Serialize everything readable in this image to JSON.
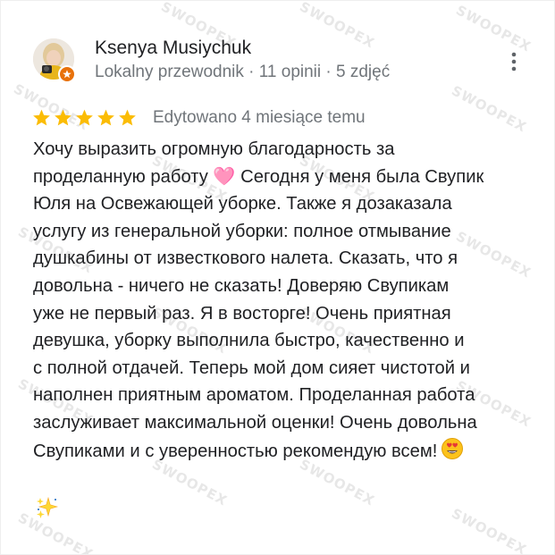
{
  "reviewer": {
    "name": "Ksenya Musiychuk",
    "meta": "Lokalny przewodnik · 11 opinii · 5 zdjęć",
    "badge_icon": "local-guide-badge-icon",
    "badge_color": "#e8710a"
  },
  "review": {
    "rating": 5,
    "max_rating": 5,
    "star_color": "#fbbc04",
    "edited": "Edytowano 4 miesiące temu",
    "lines": [
      "Хочу выразить огромную благодарность за",
      "проделанную работу 🩷 Сегодня у меня была Свупик",
      "Юля на Освежающей уборке. Также я дозаказала",
      "услугу из генеральной уборки: полное отмывание",
      "душкабины от известкового налета. Сказать, что я",
      "довольна - ничего не сказать! Доверяю Свупикам",
      "уже не первый раз. Я в восторге! Очень приятная",
      "девушка, уборку выполнила быстро, качественно и",
      "с полной отдачей. Теперь мой дом сияет чистотой и",
      "наполнен приятным ароматом. Проделанная работа",
      "заслуживает максимальной оценки! Очень довольна",
      "Свупиками и с уверенностью рекомендую всем!"
    ],
    "emoji_end": "heart-eyes-emoji",
    "emoji_next_line": "sparkles-emoji"
  },
  "menu": {
    "icon": "more-vertical-icon"
  },
  "watermark": {
    "text": "SWOOPEX"
  }
}
